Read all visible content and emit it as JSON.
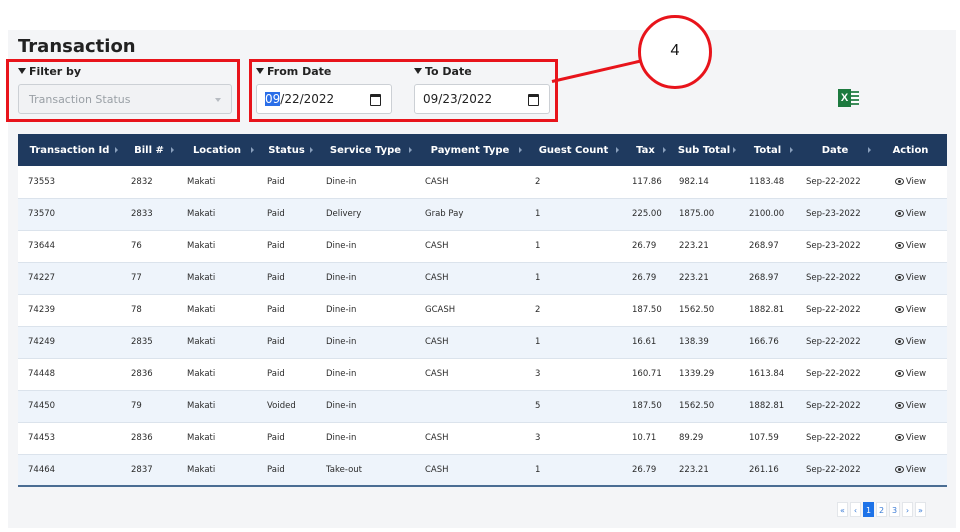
{
  "page": {
    "title": "Transaction"
  },
  "filters": {
    "filter_by_label": "Filter by",
    "status_placeholder": "Transaction Status",
    "from_date_label": "From Date",
    "from_date_value_sel": "09",
    "from_date_value_rest": "/22/2022",
    "to_date_label": "To Date",
    "to_date_value": "09/23/2022"
  },
  "annotation": {
    "number": "4"
  },
  "export": {
    "icon": "excel-icon",
    "letter": "X"
  },
  "table": {
    "headers": [
      "Transaction Id",
      "Bill #",
      "Location",
      "Status",
      "Service Type",
      "Payment Type",
      "Guest Count",
      "Tax",
      "Sub Total",
      "Total",
      "Date",
      "Action"
    ],
    "rows": [
      [
        "73553",
        "2832",
        "Makati",
        "Paid",
        "Dine-in",
        "CASH",
        "2",
        "117.86",
        "982.14",
        "1183.48",
        "Sep-22-2022",
        "View"
      ],
      [
        "73570",
        "2833",
        "Makati",
        "Paid",
        "Delivery",
        "Grab Pay",
        "1",
        "225.00",
        "1875.00",
        "2100.00",
        "Sep-23-2022",
        "View"
      ],
      [
        "73644",
        "76",
        "Makati",
        "Paid",
        "Dine-in",
        "CASH",
        "1",
        "26.79",
        "223.21",
        "268.97",
        "Sep-23-2022",
        "View"
      ],
      [
        "74227",
        "77",
        "Makati",
        "Paid",
        "Dine-in",
        "CASH",
        "1",
        "26.79",
        "223.21",
        "268.97",
        "Sep-22-2022",
        "View"
      ],
      [
        "74239",
        "78",
        "Makati",
        "Paid",
        "Dine-in",
        "GCASH",
        "2",
        "187.50",
        "1562.50",
        "1882.81",
        "Sep-22-2022",
        "View"
      ],
      [
        "74249",
        "2835",
        "Makati",
        "Paid",
        "Dine-in",
        "CASH",
        "1",
        "16.61",
        "138.39",
        "166.76",
        "Sep-22-2022",
        "View"
      ],
      [
        "74448",
        "2836",
        "Makati",
        "Paid",
        "Dine-in",
        "CASH",
        "3",
        "160.71",
        "1339.29",
        "1613.84",
        "Sep-22-2022",
        "View"
      ],
      [
        "74450",
        "79",
        "Makati",
        "Voided",
        "Dine-in",
        "",
        "5",
        "187.50",
        "1562.50",
        "1882.81",
        "Sep-22-2022",
        "View"
      ],
      [
        "74453",
        "2836",
        "Makati",
        "Paid",
        "Dine-in",
        "CASH",
        "3",
        "10.71",
        "89.29",
        "107.59",
        "Sep-22-2022",
        "View"
      ],
      [
        "74464",
        "2837",
        "Makati",
        "Paid",
        "Take-out",
        "CASH",
        "1",
        "26.79",
        "223.21",
        "261.16",
        "Sep-22-2022",
        "View"
      ]
    ]
  },
  "pagination": {
    "items": [
      {
        "label": "«",
        "active": false,
        "name": "first-page-button"
      },
      {
        "label": "‹",
        "active": false,
        "name": "prev-page-button"
      },
      {
        "label": "1",
        "active": true,
        "name": "page-1-button"
      },
      {
        "label": "2",
        "active": false,
        "name": "page-2-button"
      },
      {
        "label": "3",
        "active": false,
        "name": "page-3-button"
      },
      {
        "label": "›",
        "active": false,
        "name": "next-page-button"
      },
      {
        "label": "»",
        "active": false,
        "name": "last-page-button"
      }
    ]
  },
  "colors": {
    "accent_red": "#e8141b",
    "header_navy": "#1f3a5f",
    "page_active": "#1e73e8",
    "excel_green": "#1d7a3f"
  }
}
